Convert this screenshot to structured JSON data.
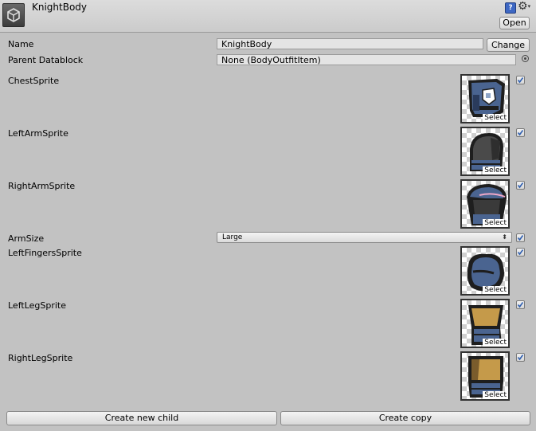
{
  "header": {
    "title": "KnightBody",
    "open_label": "Open",
    "help_icon_text": "?"
  },
  "fields": {
    "name_label": "Name",
    "name_value": "KnightBody",
    "change_label": "Change",
    "parent_label": "Parent Datablock",
    "parent_value": "None (BodyOutfitItem)"
  },
  "sprites": [
    {
      "label": "ChestSprite",
      "select_label": "Select",
      "icon": "chest-sprite-icon",
      "checked": true
    },
    {
      "label": "LeftArmSprite",
      "select_label": "Select",
      "icon": "left-arm-sprite-icon",
      "checked": true
    },
    {
      "label": "RightArmSprite",
      "select_label": "Select",
      "icon": "right-arm-sprite-icon",
      "checked": true
    },
    {
      "label": "LeftFingersSprite",
      "select_label": "Select",
      "icon": "left-fingers-sprite-icon",
      "checked": true
    },
    {
      "label": "LeftLegSprite",
      "select_label": "Select",
      "icon": "left-leg-sprite-icon",
      "checked": true
    },
    {
      "label": "RightLegSprite",
      "select_label": "Select",
      "icon": "right-leg-sprite-icon",
      "checked": true
    }
  ],
  "arm_size": {
    "label": "ArmSize",
    "value": "Large",
    "checked": true
  },
  "buttons": {
    "create_child": "Create new child",
    "create_copy": "Create copy"
  },
  "colors": {
    "background": "#c2c2c2",
    "checkmark": "#2f5fb0",
    "armor_blue": "#4a6490",
    "armor_dark": "#2d2d2d",
    "leg_gold": "#c59a4a"
  }
}
